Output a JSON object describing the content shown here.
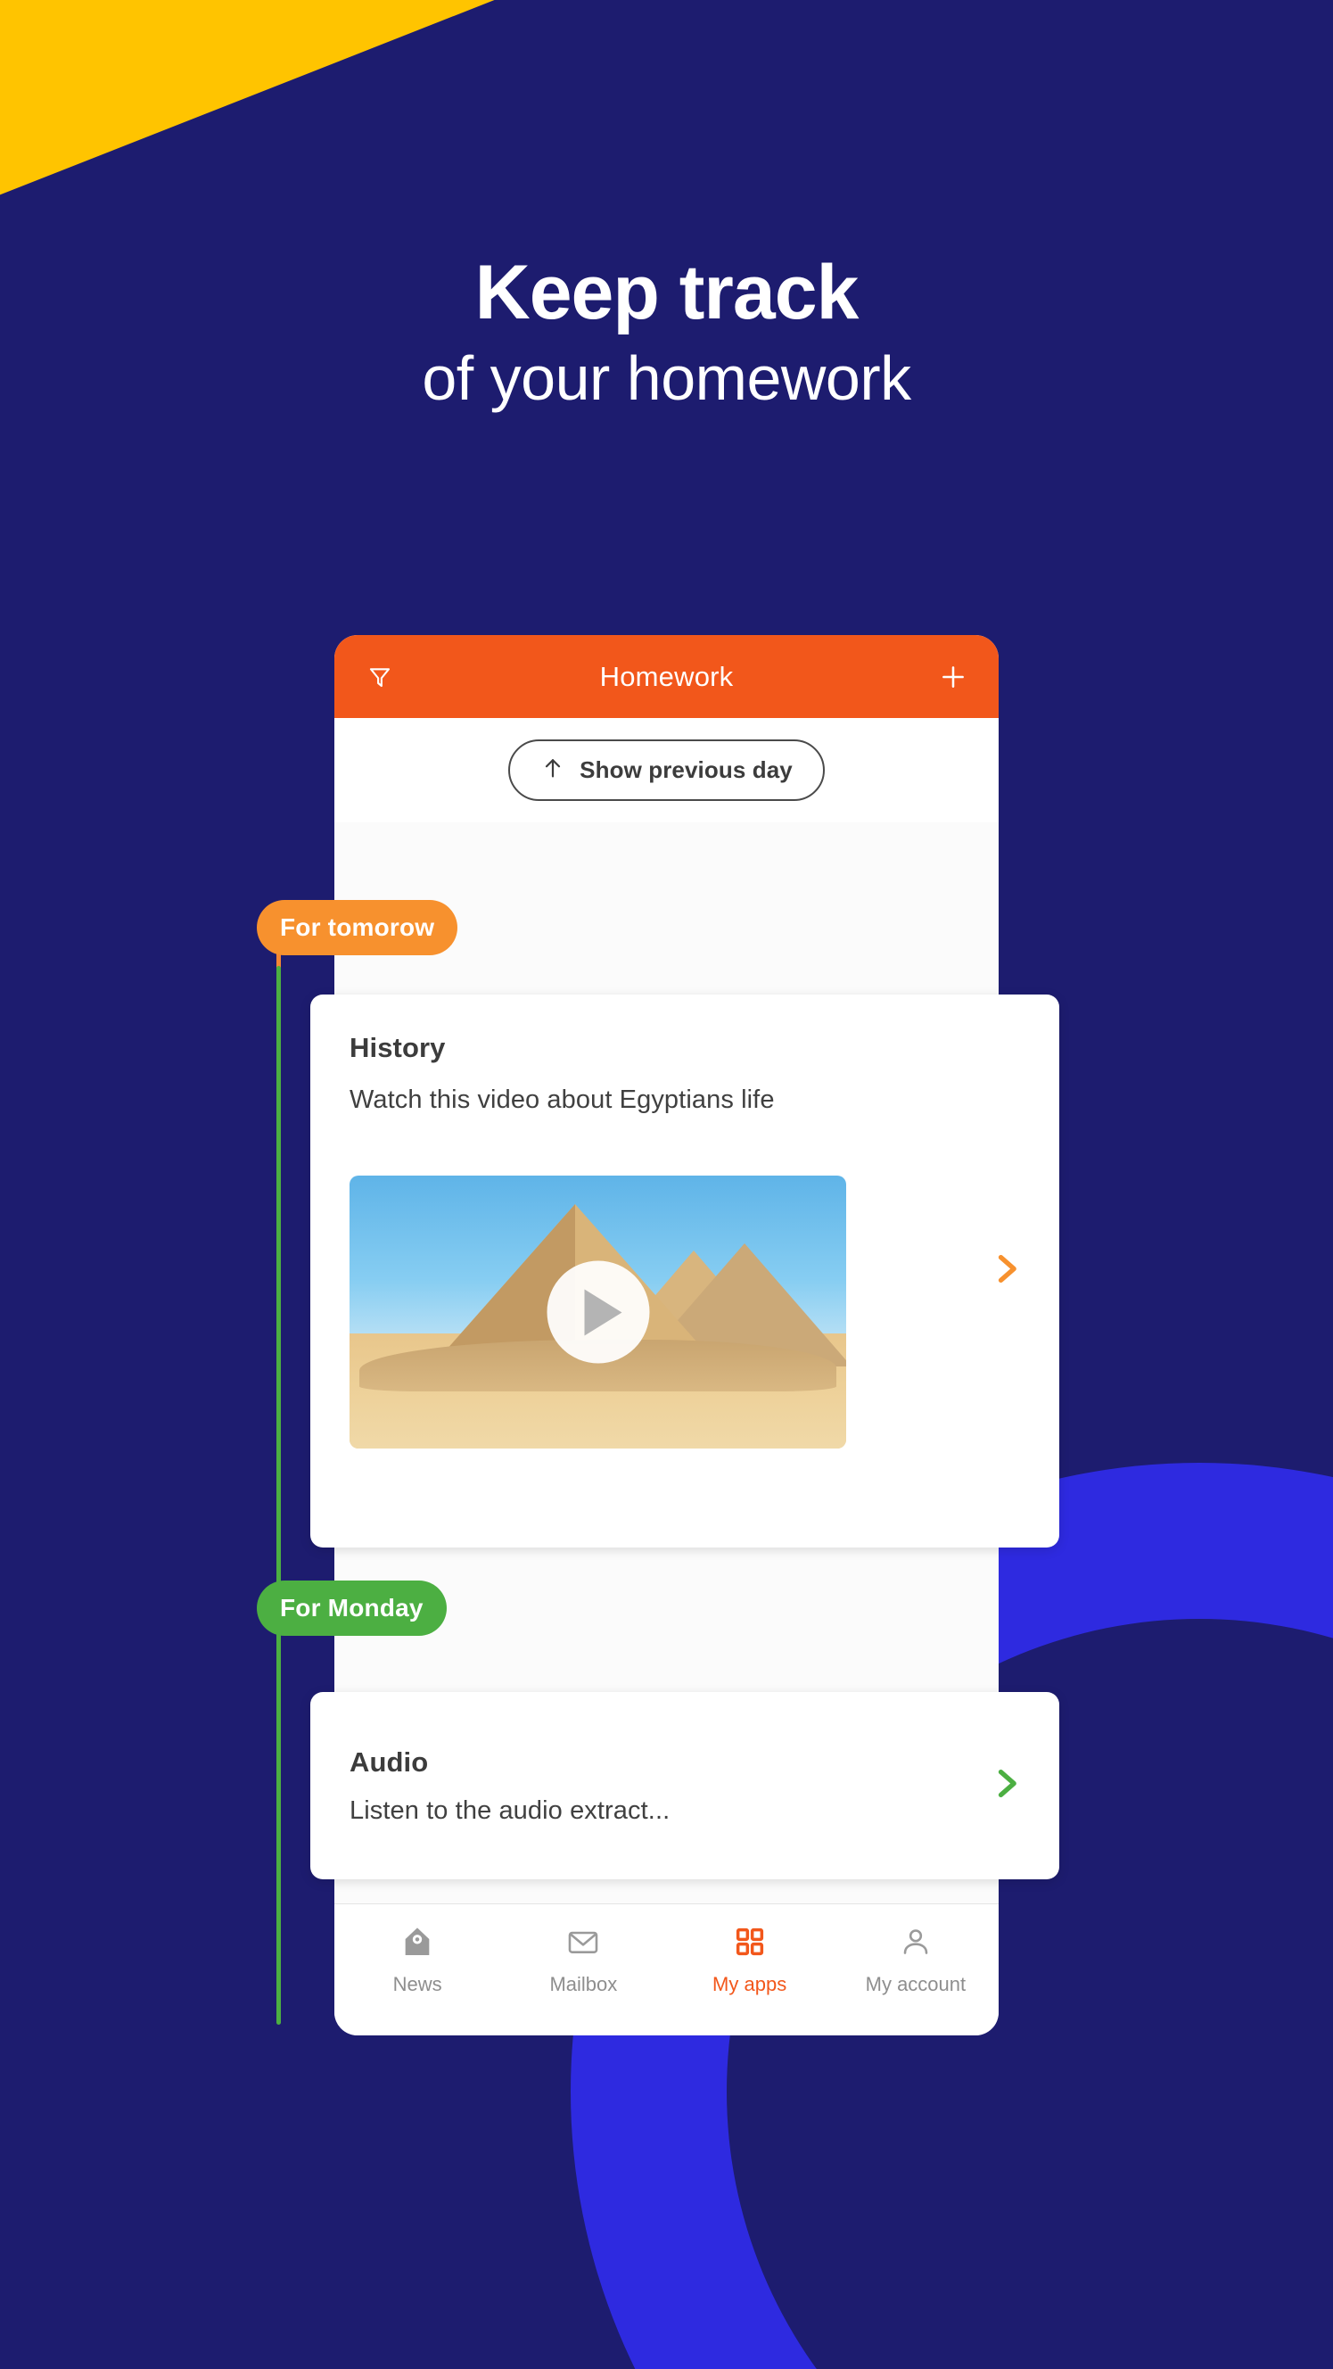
{
  "headline": {
    "line1": "Keep track",
    "line2": "of your homework"
  },
  "colors": {
    "background_navy": "#1d1c6f",
    "accent_yellow": "#ffc400",
    "accent_blue": "#2e2ae0",
    "appbar_orange": "#f2571b",
    "badge_orange": "#f7912e",
    "badge_green": "#4caf42",
    "chevron_orange": "#f7912e",
    "chevron_green": "#4caf42",
    "timeline_orange": "#f58634",
    "timeline_green": "#4caf42"
  },
  "phone": {
    "appbar": {
      "title": "Homework",
      "filter_icon": "filter-funnel-icon",
      "add_icon": "plus-icon"
    },
    "previous_day_button": {
      "label": "Show previous day",
      "icon": "arrow-up-icon"
    },
    "sections": [
      {
        "badge": "For tomorow",
        "badge_color": "#f7912e",
        "items": [
          {
            "title": "History",
            "description": "Watch this video about Egyptians life",
            "media": "video-thumbnail-pyramids",
            "media_overlay_icon": "play-icon",
            "chevron_icon": "chevron-right-icon",
            "chevron_color": "#f7912e"
          }
        ]
      },
      {
        "badge": "For Monday",
        "badge_color": "#4caf42",
        "items": [
          {
            "title": "Audio",
            "description": "Listen to the audio extract...",
            "chevron_icon": "chevron-right-icon",
            "chevron_color": "#4caf42"
          }
        ]
      }
    ],
    "bottom_nav": [
      {
        "label": "News",
        "icon": "house-news-icon",
        "active": false
      },
      {
        "label": "Mailbox",
        "icon": "envelope-icon",
        "active": false
      },
      {
        "label": "My apps",
        "icon": "grid-apps-icon",
        "active": true
      },
      {
        "label": "My account",
        "icon": "person-icon",
        "active": false
      }
    ]
  }
}
